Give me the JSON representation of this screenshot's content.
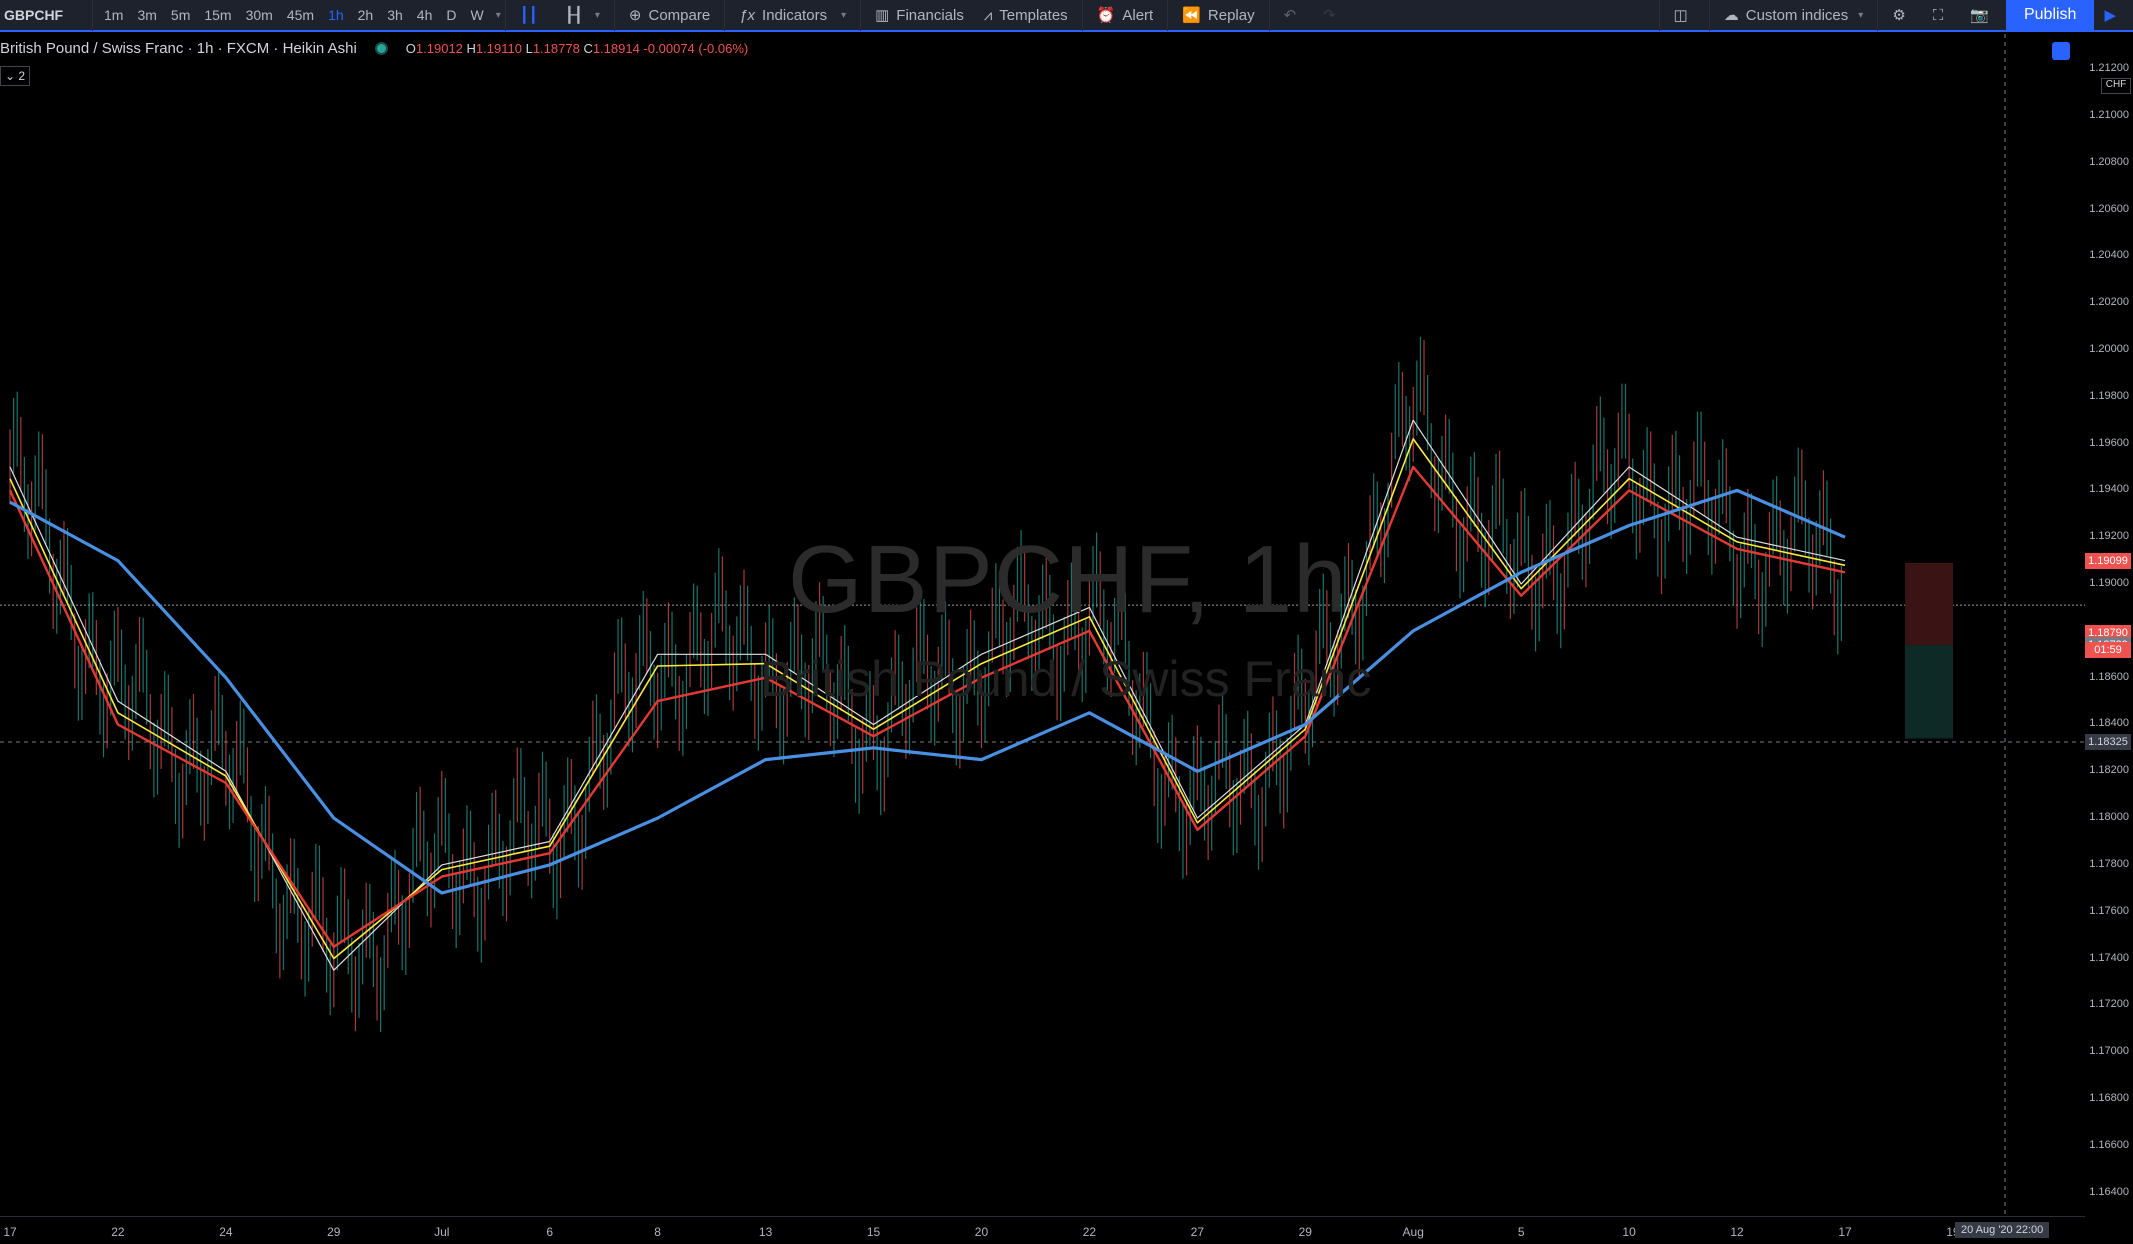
{
  "toolbar": {
    "symbol": "GBPCHF",
    "intervals": [
      "1m",
      "3m",
      "5m",
      "15m",
      "30m",
      "45m",
      "1h",
      "2h",
      "3h",
      "4h",
      "D",
      "W"
    ],
    "active_interval": "1h",
    "compare": "Compare",
    "indicators": "Indicators",
    "financials": "Financials",
    "templates": "Templates",
    "alert": "Alert",
    "replay": "Replay",
    "custom_indices": "Custom indices",
    "publish": "Publish"
  },
  "legend": {
    "title": "British Pound / Swiss Franc · 1h · FXCM · Heikin Ashi",
    "o_label": "O",
    "o": "1.19012",
    "h_label": "H",
    "h": "1.19110",
    "l_label": "L",
    "l": "1.18778",
    "c_label": "C",
    "c": "1.18914",
    "change": "-0.00074 (-0.06%)",
    "collapse": "⌄ 2"
  },
  "watermark": {
    "symbol": "GBPCHF, 1h",
    "name": "British Pound / Swiss Franc"
  },
  "currency": "CHF",
  "price_axis": {
    "ticks": [
      "1.21200",
      "1.21000",
      "1.20800",
      "1.20600",
      "1.20400",
      "1.20200",
      "1.20000",
      "1.19800",
      "1.19600",
      "1.19400",
      "1.19200",
      "1.19000",
      "1.18800",
      "1.18600",
      "1.18400",
      "1.18200",
      "1.18000",
      "1.17800",
      "1.17600",
      "1.17400",
      "1.17200",
      "1.17000",
      "1.16800",
      "1.16600",
      "1.16400"
    ],
    "tag_high": "1.19099",
    "tag_low": "1.18790",
    "countdown": "01:59",
    "tag_last": "1.18739",
    "tag_cursor": "1.18325"
  },
  "time_axis": {
    "labels": [
      "17",
      "22",
      "24",
      "29",
      "Jul",
      "6",
      "8",
      "13",
      "15",
      "20",
      "22",
      "27",
      "29",
      "Aug",
      "5",
      "10",
      "12",
      "17",
      "19"
    ],
    "cursor_label": "20 Aug '20  22:00"
  },
  "colors": {
    "ma_blue": "#4a90e2",
    "ma_red": "#e53935",
    "ma_yellow": "#ffeb3b",
    "ma_white": "#e0e0e0",
    "up": "#26a69a",
    "down": "#ef5350"
  },
  "chart_data": {
    "type": "line",
    "title": "British Pound / Swiss Franc · 1h · FXCM · Heikin Ashi",
    "ylim": [
      1.163,
      1.2135
    ],
    "x": [
      "17",
      "22",
      "24",
      "29",
      "Jul",
      "6",
      "8",
      "13",
      "15",
      "20",
      "22",
      "27",
      "29",
      "Aug",
      "5",
      "10",
      "12",
      "17"
    ],
    "series": [
      {
        "values": [
          1.195,
          1.185,
          1.182,
          1.1735,
          1.178,
          1.179,
          1.187,
          1.187,
          1.184,
          1.187,
          1.189,
          1.18,
          1.184,
          1.197,
          1.19,
          1.195,
          1.192,
          1.191
        ]
      },
      {
        "values": [
          1.1945,
          1.1845,
          1.1818,
          1.174,
          1.1778,
          1.1788,
          1.1865,
          1.1866,
          1.1838,
          1.1866,
          1.1886,
          1.1798,
          1.1838,
          1.1962,
          1.1898,
          1.1945,
          1.1918,
          1.1908
        ]
      },
      {
        "values": [
          1.194,
          1.184,
          1.1815,
          1.1745,
          1.1775,
          1.1785,
          1.185,
          1.186,
          1.1835,
          1.186,
          1.188,
          1.1795,
          1.1835,
          1.195,
          1.1895,
          1.194,
          1.1915,
          1.1905
        ]
      },
      {
        "values": [
          1.1935,
          1.191,
          1.186,
          1.18,
          1.1768,
          1.178,
          1.18,
          1.1825,
          1.183,
          1.1825,
          1.1845,
          1.182,
          1.184,
          1.188,
          1.1905,
          1.1925,
          1.194,
          1.192
        ]
      }
    ]
  }
}
